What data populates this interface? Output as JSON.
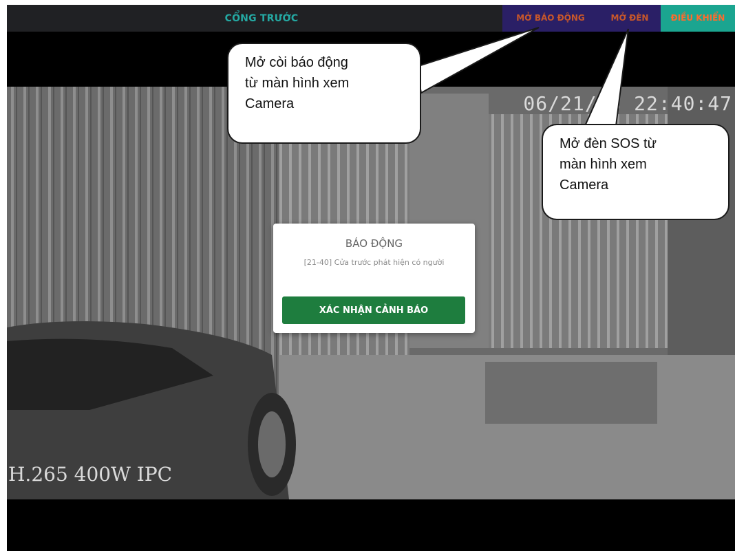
{
  "topbar": {
    "title": "CỔNG TRƯỚC",
    "buttons": {
      "alarm": "MỞ BÁO ĐỘNG",
      "light": "MỞ ĐÈN",
      "control": "ĐIỀU KHIỂN"
    }
  },
  "video": {
    "timestamp": "06/21/  3 22:40:47",
    "codec": "H.265 400W IPC"
  },
  "dialog": {
    "title": "BÁO ĐỘNG",
    "message": "[21-40] Cửa trước phát hiện có người",
    "confirm": "XÁC NHẬN CẢNH BÁO"
  },
  "callouts": {
    "alarm_line1": "Mở còi báo động",
    "alarm_line2": "từ màn hình xem",
    "alarm_line3": "Camera",
    "light_line1": "Mở đèn SOS từ",
    "light_line2": "màn hình xem",
    "light_line3": "Camera"
  }
}
